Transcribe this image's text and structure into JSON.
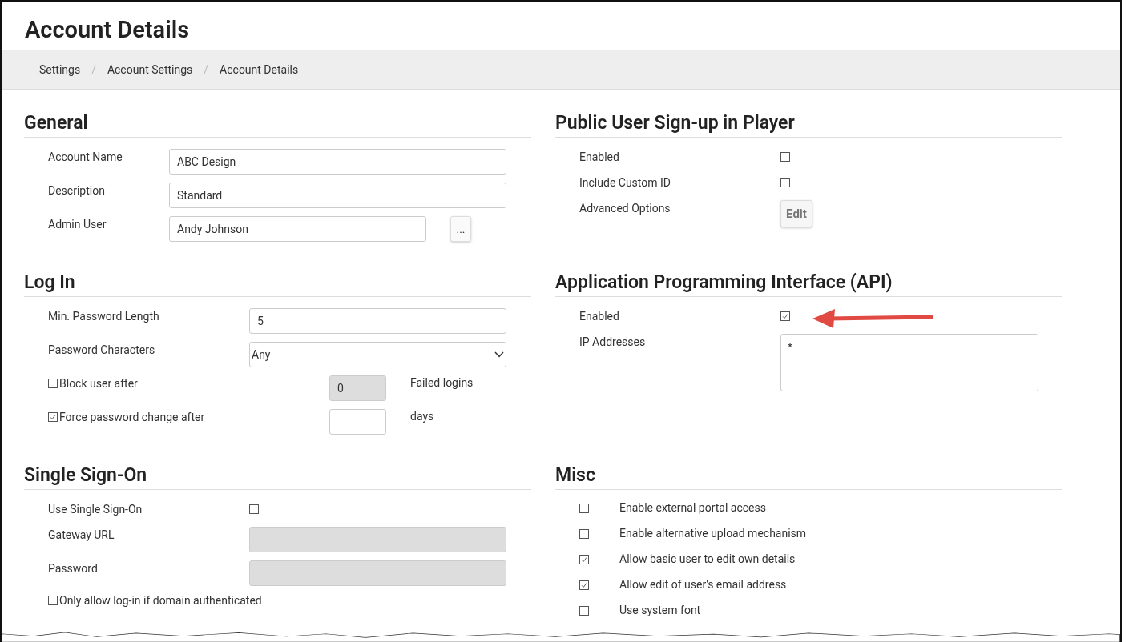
{
  "page_title": "Account Details",
  "breadcrumb": [
    {
      "kind": "link",
      "text": "Settings"
    },
    {
      "kind": "separator",
      "text": "/"
    },
    {
      "kind": "link",
      "text": "Account Settings"
    },
    {
      "kind": "separator",
      "text": "/"
    },
    {
      "kind": "link",
      "text": "Account Details"
    }
  ],
  "columns": [
    [
      {
        "title": "General",
        "rows": [
          {
            "kind": "text",
            "label": "Account Name",
            "value": "ABC Design"
          },
          {
            "kind": "text",
            "label": "Description",
            "value": "Standard"
          },
          {
            "kind": "text_button",
            "label": "Admin User",
            "value": "Andy Johnson",
            "button": "..."
          }
        ]
      },
      {
        "title": "Log In",
        "rows": [
          {
            "kind": "text",
            "label": "Min. Password Length",
            "value": "5"
          },
          {
            "kind": "select",
            "label": "Password Characters",
            "value": "Any"
          },
          {
            "kind": "check_field",
            "label": "Block user after",
            "checked": false,
            "value": "0",
            "disabled": true,
            "suffix": "Failed logins"
          },
          {
            "kind": "check_field",
            "label": "Force password change after",
            "checked": true,
            "value": "",
            "disabled": false,
            "suffix": "days"
          }
        ]
      },
      {
        "title": "Single Sign-On",
        "rows": [
          {
            "kind": "checkbox",
            "label": "Use Single Sign-On",
            "checked": false
          },
          {
            "kind": "text",
            "label": "Gateway URL",
            "value": "",
            "disabled": true
          },
          {
            "kind": "text",
            "label": "Password",
            "value": "",
            "disabled": true
          },
          {
            "kind": "check_only",
            "label": "Only allow log-in if domain authenticated",
            "checked": false
          }
        ]
      }
    ],
    [
      {
        "title": "Public User Sign-up in Player",
        "rows": [
          {
            "kind": "checkbox",
            "label": "Enabled",
            "checked": false
          },
          {
            "kind": "checkbox",
            "label": "Include Custom ID",
            "checked": false
          },
          {
            "kind": "button",
            "label": "Advanced Options",
            "button": "Edit"
          }
        ]
      },
      {
        "title": "Application Programming Interface (API)",
        "rows": [
          {
            "kind": "checkbox",
            "label": "Enabled",
            "checked": true
          },
          {
            "kind": "textarea",
            "label": "IP Addresses",
            "value": "*"
          }
        ]
      },
      {
        "title": "Misc",
        "rows": [
          {
            "kind": "misc",
            "label": "Enable external portal access",
            "checked": false
          },
          {
            "kind": "misc",
            "label": "Enable alternative upload mechanism",
            "checked": false
          },
          {
            "kind": "misc",
            "label": "Allow basic user to edit own details",
            "checked": true
          },
          {
            "kind": "misc",
            "label": "Allow edit of user's email address",
            "checked": true
          },
          {
            "kind": "misc",
            "label": "Use system font",
            "checked": false
          }
        ]
      }
    ]
  ]
}
